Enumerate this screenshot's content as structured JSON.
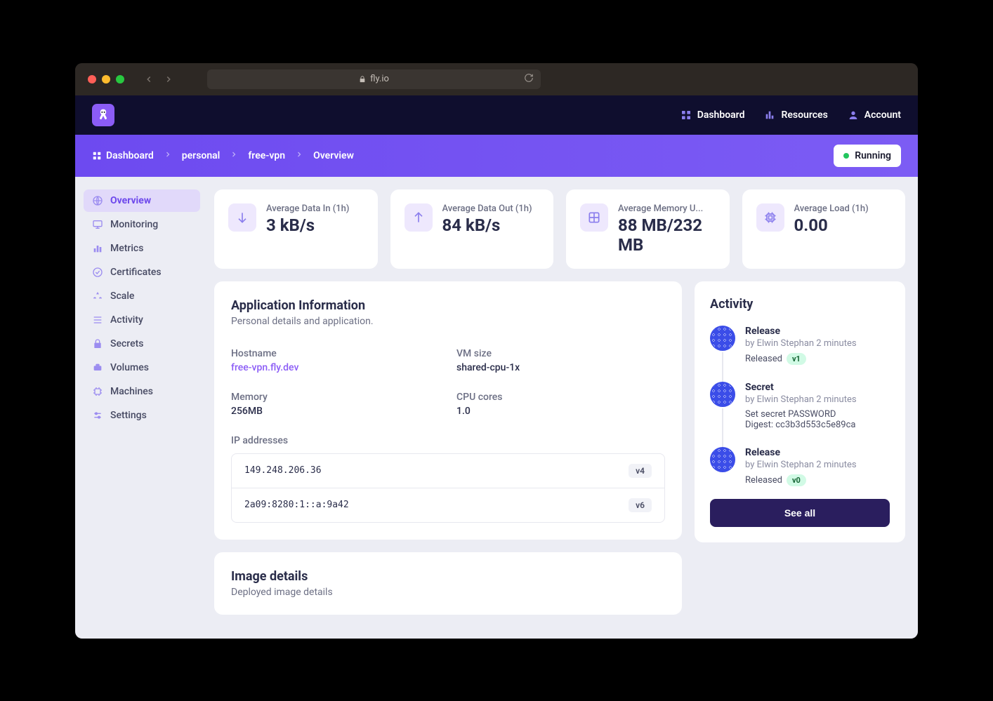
{
  "browser": {
    "url_host": "fly.io"
  },
  "header": {
    "nav": [
      {
        "label": "Dashboard",
        "icon": "dashboard-icon"
      },
      {
        "label": "Resources",
        "icon": "resources-icon"
      },
      {
        "label": "Account",
        "icon": "account-icon"
      }
    ]
  },
  "breadcrumb": {
    "items": [
      "Dashboard",
      "personal",
      "free-vpn",
      "Overview"
    ]
  },
  "status": {
    "label": "Running"
  },
  "sidebar": {
    "items": [
      {
        "label": "Overview",
        "icon": "globe-icon",
        "active": true
      },
      {
        "label": "Monitoring",
        "icon": "monitor-icon"
      },
      {
        "label": "Metrics",
        "icon": "barchart-icon"
      },
      {
        "label": "Certificates",
        "icon": "cert-icon"
      },
      {
        "label": "Scale",
        "icon": "scale-icon"
      },
      {
        "label": "Activity",
        "icon": "activity-icon"
      },
      {
        "label": "Secrets",
        "icon": "lock-icon"
      },
      {
        "label": "Volumes",
        "icon": "volumes-icon"
      },
      {
        "label": "Machines",
        "icon": "machines-icon"
      },
      {
        "label": "Settings",
        "icon": "settings-icon"
      }
    ]
  },
  "stats": [
    {
      "label": "Average Data In (1h)",
      "value": "3 kB/s",
      "icon": "down-arrow-icon"
    },
    {
      "label": "Average Data Out (1h)",
      "value": "84 kB/s",
      "icon": "up-arrow-icon"
    },
    {
      "label": "Average Memory U...",
      "value": "88 MB/232 MB",
      "icon": "grid-icon"
    },
    {
      "label": "Average Load (1h)",
      "value": "0.00",
      "icon": "cpu-icon"
    }
  ],
  "app_info": {
    "title": "Application Information",
    "subtitle": "Personal details and application.",
    "fields": {
      "hostname_label": "Hostname",
      "hostname_value": "free-vpn.fly.dev",
      "vmsize_label": "VM size",
      "vmsize_value": "shared-cpu-1x",
      "memory_label": "Memory",
      "memory_value": "256MB",
      "cpu_label": "CPU cores",
      "cpu_value": "1.0"
    },
    "ip_section_label": "IP addresses",
    "ips": [
      {
        "addr": "149.248.206.36",
        "ver": "v4"
      },
      {
        "addr": "2a09:8280:1::a:9a42",
        "ver": "v6"
      }
    ]
  },
  "activity": {
    "title": "Activity",
    "items": [
      {
        "title": "Release",
        "meta": "by Elwin Stephan 2 minutes",
        "detail_text": "Released",
        "version": "v1"
      },
      {
        "title": "Secret",
        "meta": "by Elwin Stephan 2 minutes",
        "detail_line1": "Set secret PASSWORD",
        "detail_line2": "Digest: cc3b3d553c5e89ca"
      },
      {
        "title": "Release",
        "meta": "by Elwin Stephan 2 minutes",
        "detail_text": "Released",
        "version": "v0"
      }
    ],
    "see_all_label": "See all"
  },
  "image_details": {
    "title": "Image details",
    "subtitle": "Deployed image details"
  }
}
